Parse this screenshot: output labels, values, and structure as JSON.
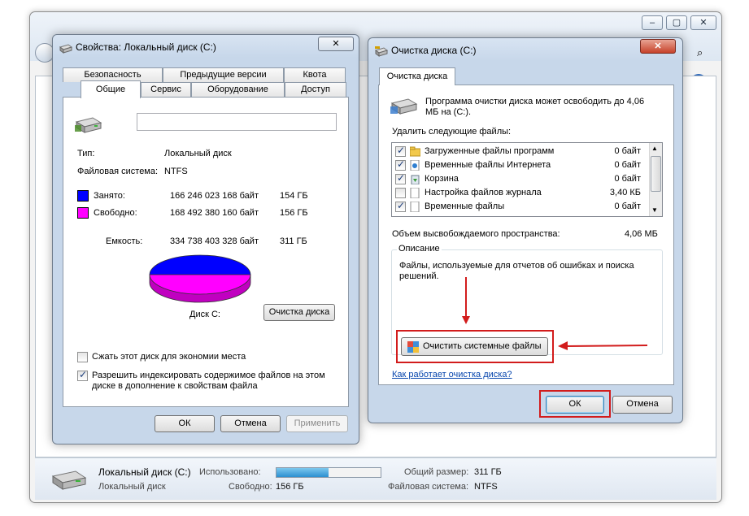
{
  "explorer": {
    "statusbar": {
      "drive_name": "Локальный диск (C:)",
      "drive_type": "Локальный диск",
      "used_label": "Использовано:",
      "free_label": "Свободно:",
      "free_value": "156 ГБ",
      "total_label": "Общий размер:",
      "total_value": "311 ГБ",
      "fs_label": "Файловая система:",
      "fs_value": "NTFS",
      "used_fraction": 0.5
    }
  },
  "properties": {
    "title": "Свойства: Локальный диск (C:)",
    "close_glyph": "✕",
    "tabs_top": [
      "Безопасность",
      "Предыдущие версии",
      "Квота"
    ],
    "tabs_bottom": [
      "Общие",
      "Сервис",
      "Оборудование",
      "Доступ"
    ],
    "active_tab": "Общие",
    "name_value": "",
    "type_label": "Тип:",
    "type_value": "Локальный диск",
    "fs_label": "Файловая система:",
    "fs_value": "NTFS",
    "used_label": "Занято:",
    "used_bytes": "166 246 023 168 байт",
    "used_gb": "154 ГБ",
    "free_label": "Свободно:",
    "free_bytes": "168 492 380 160 байт",
    "free_gb": "156 ГБ",
    "capacity_label": "Емкость:",
    "capacity_bytes": "334 738 403 328 байт",
    "capacity_gb": "311 ГБ",
    "disk_label": "Диск C:",
    "cleanup_button": "Очистка диска",
    "compress_label": "Сжать этот диск для экономии места",
    "compress_checked": false,
    "index_label_1": "Разрешить индексировать содержимое файлов на этом",
    "index_label_2": "диске в дополнение к свойствам файла",
    "index_checked": true,
    "ok": "ОК",
    "cancel": "Отмена",
    "apply": "Применить",
    "colors": {
      "used": "#0000ff",
      "free": "#ff00ff"
    }
  },
  "cleanup": {
    "title": "Очистка диска  (C:)",
    "close_glyph": "✕",
    "tab": "Очистка диска",
    "intro_1": "Программа очистки диска может освободить до 4,06",
    "intro_2": "МБ на  (C:).",
    "delete_label": "Удалить следующие файлы:",
    "files": [
      {
        "name": "Загруженные файлы программ",
        "size": "0 байт",
        "checked": true,
        "icon": "folder-icon"
      },
      {
        "name": "Временные файлы Интернета",
        "size": "0 байт",
        "checked": true,
        "icon": "internet-files-icon"
      },
      {
        "name": "Корзина",
        "size": "0 байт",
        "checked": true,
        "icon": "recycle-bin-icon"
      },
      {
        "name": "Настройка файлов журнала",
        "size": "3,40 КБ",
        "checked": false,
        "icon": "file-icon"
      },
      {
        "name": "Временные файлы",
        "size": "0 байт",
        "checked": true,
        "icon": "file-icon"
      }
    ],
    "freed_label": "Объем высвобождаемого пространства:",
    "freed_value": "4,06 МБ",
    "description_legend": "Описание",
    "description_1": "Файлы, используемые для отчетов об ошибках и поиска",
    "description_2": "решений.",
    "clean_system_button": "Очистить системные файлы",
    "how_link": "Как работает очистка диска?",
    "ok": "ОК",
    "cancel": "Отмена"
  }
}
